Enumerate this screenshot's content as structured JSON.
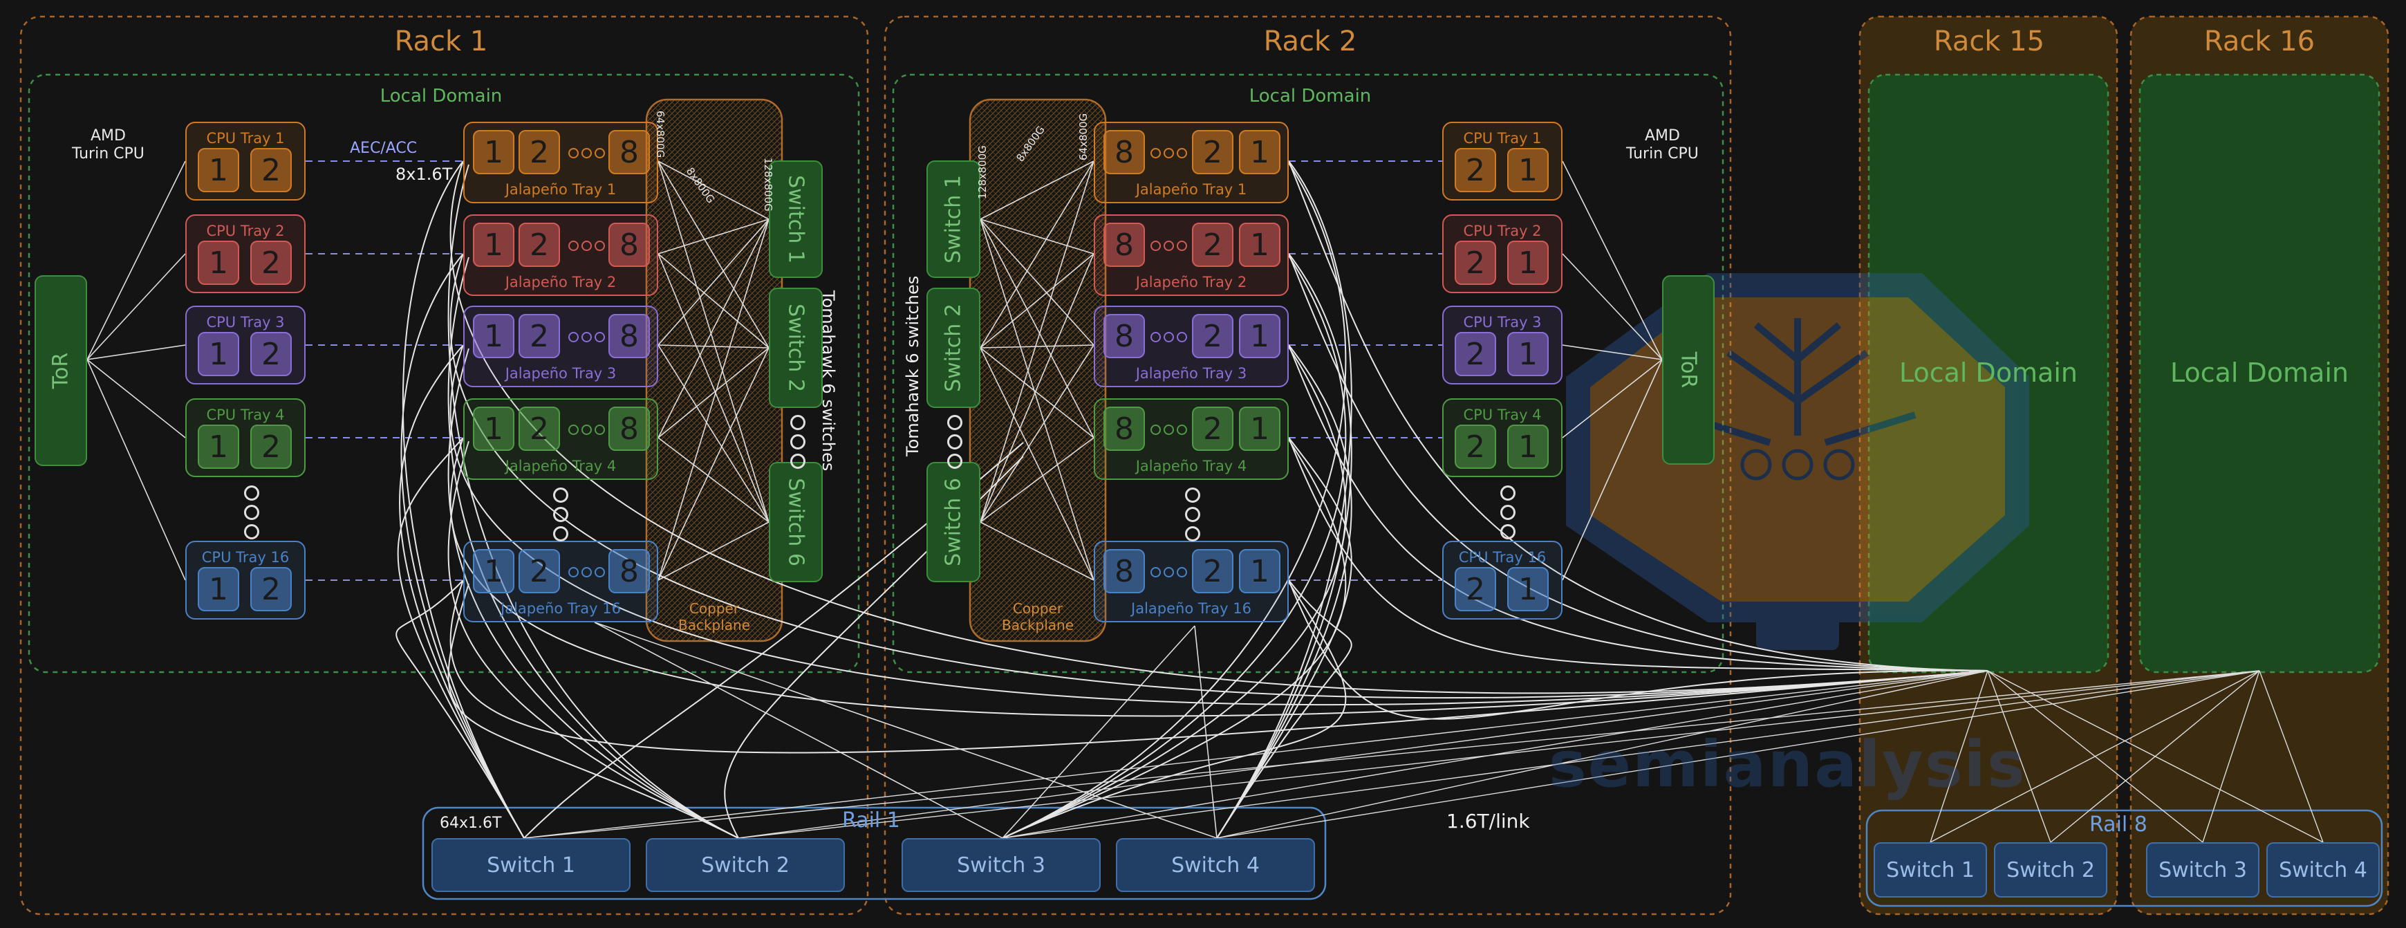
{
  "colors": {
    "rack_border": "#a8652a",
    "domain_border": "#3e8f45",
    "cpu1": "#d27a22",
    "cpu2": "#d25a55",
    "cpu3": "#8a6ed8",
    "cpu4": "#4f9a45",
    "cpu16": "#4a82c8",
    "switch_green": "#1f5122",
    "rail_blue": "#213e64",
    "wire": "#e8e8e8",
    "dashed_link": "#8a8ee6"
  },
  "racks": [
    {
      "title": "Rack 1"
    },
    {
      "title": "Rack 2"
    },
    {
      "title": "Rack 15"
    },
    {
      "title": "Rack 16"
    }
  ],
  "domain_label": "Local Domain",
  "cpu_label": "AMD\nTurin CPU",
  "cpu_label_line1": "AMD",
  "cpu_label_line2": "Turin CPU",
  "tor_label": "ToR",
  "aec_label": "AEC/ACC",
  "link_8x": "8x1.6T",
  "cpu_trays": [
    "CPU Tray 1",
    "CPU Tray 2",
    "CPU Tray 3",
    "CPU Tray 4",
    "CPU Tray 16"
  ],
  "jal_trays": [
    "Jalapeño Tray 1",
    "Jalapeño Tray 2",
    "Jalapeño Tray 3",
    "Jalapeño Tray 4",
    "Jalapeño Tray 16"
  ],
  "chip_1": "1",
  "chip_2": "2",
  "chip_8": "8",
  "backplane_label": "Copper Backplane",
  "bp_line1": "Copper",
  "bp_line2": "Backplane",
  "bp_tick_a": "64x800G",
  "bp_tick_b": "8x800G",
  "bp_tick_c": "128x800G",
  "tomahawk_label": "Tomahawk 6 switches",
  "scale_switches": [
    "Switch 1",
    "Switch 2",
    "Switch 6"
  ],
  "rail_switches": [
    "Switch 1",
    "Switch 2",
    "Switch 3",
    "Switch 4"
  ],
  "rail1_label": "Rail 1",
  "rail8_label": "Rail 8",
  "rail_uplink": "64x1.6T",
  "link_rate": "1.6T/link",
  "watermark": "semianalysis"
}
